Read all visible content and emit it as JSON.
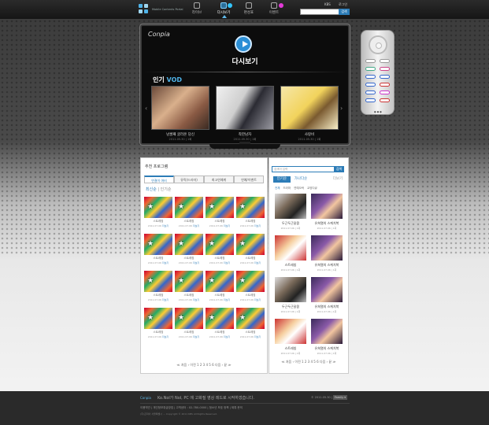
{
  "header": {
    "logo_text": "Mobile Contents Portal",
    "nav": [
      {
        "label": "라이브"
      },
      {
        "label": "다시보기"
      },
      {
        "label": "편성표"
      },
      {
        "label": "이벤트"
      }
    ],
    "top_links": {
      "kbs": "KBS",
      "login": "로그인"
    },
    "search_button": "검색"
  },
  "tv": {
    "brand": "Conpia",
    "title": "다시보기",
    "popular_label": "인기",
    "popular_accent": "VOD",
    "vod_items": [
      {
        "caption": "넝쿨째 굴러온 당신",
        "date": "2011.05.30 | 1회"
      },
      {
        "caption": "착한남자",
        "date": "2011.05.30 | 1회"
      },
      {
        "caption": "사랑비",
        "date": "2011.05.30 | 1회"
      }
    ]
  },
  "left_panel": {
    "title": "추천 프로그램",
    "tabs": [
      "연결이 여러",
      "뮤직(드라마)",
      "최고연예계",
      "연예/이벤트"
    ],
    "sort": {
      "active": "최신순",
      "other": "| 인기순"
    },
    "items": [
      {
        "title": "스트레칭",
        "date": "2011.07.06",
        "flag": "더보기"
      },
      {
        "title": "스트레칭",
        "date": "2011.07.06",
        "flag": "더보기"
      },
      {
        "title": "스트레칭",
        "date": "2011.07.06",
        "flag": "더보기"
      },
      {
        "title": "스트레칭",
        "date": "2011.07.06",
        "flag": "더보기"
      },
      {
        "title": "스트레칭",
        "date": "2011.07.06",
        "flag": "더보기"
      },
      {
        "title": "스트레칭",
        "date": "2011.07.06",
        "flag": "더보기"
      },
      {
        "title": "스트레칭",
        "date": "2011.07.06",
        "flag": "더보기"
      },
      {
        "title": "스트레칭",
        "date": "2011.07.06",
        "flag": "더보기"
      },
      {
        "title": "스트레칭",
        "date": "2011.07.06",
        "flag": "더보기"
      },
      {
        "title": "스트레칭",
        "date": "2011.07.06",
        "flag": "더보기"
      },
      {
        "title": "스트레칭",
        "date": "2011.07.06",
        "flag": "더보기"
      },
      {
        "title": "스트레칭",
        "date": "2011.07.06",
        "flag": "더보기"
      },
      {
        "title": "스트레칭",
        "date": "2011.07.06",
        "flag": "더보기"
      },
      {
        "title": "스트레칭",
        "date": "2011.07.06",
        "flag": "더보기"
      },
      {
        "title": "스트레칭",
        "date": "2011.07.06",
        "flag": "더보기"
      },
      {
        "title": "스트레칭",
        "date": "2011.07.06",
        "flag": "더보기"
      }
    ],
    "pager": "≪ 처음 ‹ 이전  1  2  3  4  5  6  다음 ›  끝 ≫"
  },
  "right_panel": {
    "search_placeholder": "검색어 입력",
    "search_button": "검색",
    "tabs": [
      "인기순",
      "가나다순",
      "더보기"
    ],
    "categories": [
      "전체",
      "드라마",
      "연예오락",
      "교양다큐"
    ],
    "items": [
      {
        "title": "두근두근달콤",
        "date": "2011.07.06 | 1회"
      },
      {
        "title": "유희열의 스케치북",
        "date": "2011.07.06 | 1회"
      },
      {
        "title": "스트레칭",
        "date": "2011.07.06 | 1회"
      },
      {
        "title": "유희열의 스케치북",
        "date": "2011.07.06 | 1회"
      },
      {
        "title": "두근두근달콤",
        "date": "2011.07.06 | 1회"
      },
      {
        "title": "유희열의 스케치북",
        "date": "2011.07.06 | 1회"
      },
      {
        "title": "스트레칭",
        "date": "2011.07.06 | 1회"
      },
      {
        "title": "유희열의 스케치북",
        "date": "2011.07.06 | 1회"
      }
    ],
    "pager": "≪ 처음 ‹ 이전  1  2  3  4  5  6  다음 ›  끝 ≫"
  },
  "footer": {
    "logo": "Conpia",
    "slogan": "Ko.Nol가 Nol, PC 에 고화질 영상 레드로 시작하겠습니다.",
    "copyright": "© 2011.05.30 |",
    "family_button": "Family ▾",
    "links": "이용약관  |  개인정보취급방침  |  고객센터 : 02-780-0000  |  청소년 보호 정책  |  제휴 문의",
    "address": "(주)콘피아  서울특별시 ...  Copyright © 2011 KBS All Rights Reserved."
  },
  "colors": {
    "accent": "#2c7cb7",
    "tv_accent": "#4fb3e8",
    "footer": "#2a2a2a"
  }
}
